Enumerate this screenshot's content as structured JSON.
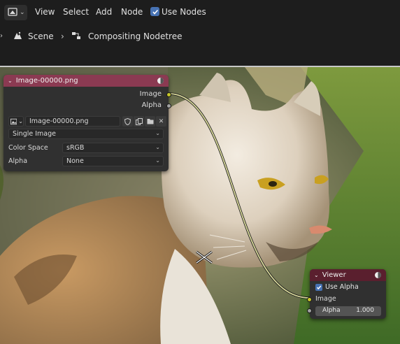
{
  "header": {
    "menus": [
      "View",
      "Select",
      "Add",
      "Node"
    ],
    "use_nodes_label": "Use Nodes",
    "use_nodes_checked": true
  },
  "breadcrumb": {
    "scene": "Scene",
    "tree": "Compositing Nodetree"
  },
  "image_node": {
    "title": "Image-00000.png",
    "outputs": [
      "Image",
      "Alpha"
    ],
    "image_name": "Image-00000.png",
    "source": "Single Image",
    "color_space_label": "Color Space",
    "color_space": "sRGB",
    "alpha_label": "Alpha",
    "alpha": "None",
    "header_color": "#8b3a52"
  },
  "viewer_node": {
    "title": "Viewer",
    "use_alpha_label": "Use Alpha",
    "use_alpha_checked": true,
    "input_image": "Image",
    "alpha_label": "Alpha",
    "alpha_value": "1.000",
    "header_color": "#5a1f2e"
  },
  "colors": {
    "image_socket": "#c7c729",
    "alpha_socket": "#a1a1a1",
    "link": "#d8d89a",
    "accent": "#4772b3"
  }
}
